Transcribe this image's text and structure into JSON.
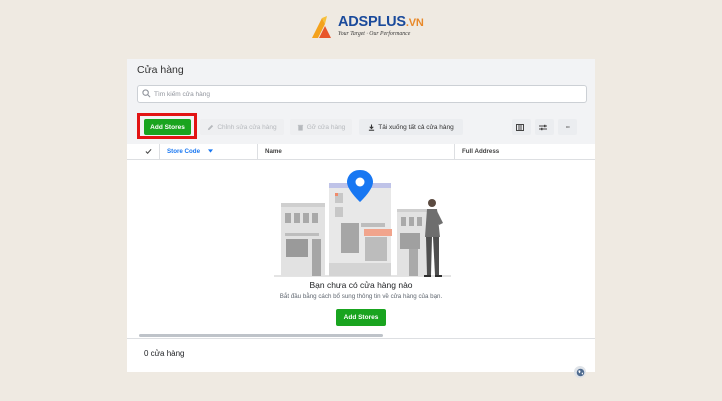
{
  "logo": {
    "brand": "ADSPLUS",
    "tld": ".VN",
    "slogan": "Your Target · Our Performance"
  },
  "page": {
    "title": "Cửa hàng",
    "search_placeholder": "Tìm kiếm cửa hàng"
  },
  "toolbar": {
    "add_stores": "Add Stores",
    "edit_store": "Chỉnh sửa cửa hàng",
    "remove_store": "Gỡ cửa hàng",
    "download_all": "Tải xuống tất cả cửa hàng",
    "more": "···"
  },
  "table": {
    "columns": [
      "Store Code",
      "Name",
      "Full Address"
    ]
  },
  "empty_state": {
    "title": "Bạn chưa có cửa hàng nào",
    "subtitle": "Bắt đầu bằng cách bổ sung thông tin về cửa hàng của bạn.",
    "button": "Add Stores"
  },
  "footer": {
    "count_text": "0 cửa hàng"
  },
  "colors": {
    "primary": "#19a41f",
    "highlight": "#e21414",
    "accent_blue": "#1877f2"
  },
  "icons": [
    "logo-icon",
    "search-icon",
    "pencil-icon",
    "trash-icon",
    "download-icon",
    "columns-icon",
    "filter-sliders-icon",
    "more-icon",
    "checkmark-icon",
    "sort-caret-icon",
    "map-pin-icon",
    "globe-icon"
  ]
}
